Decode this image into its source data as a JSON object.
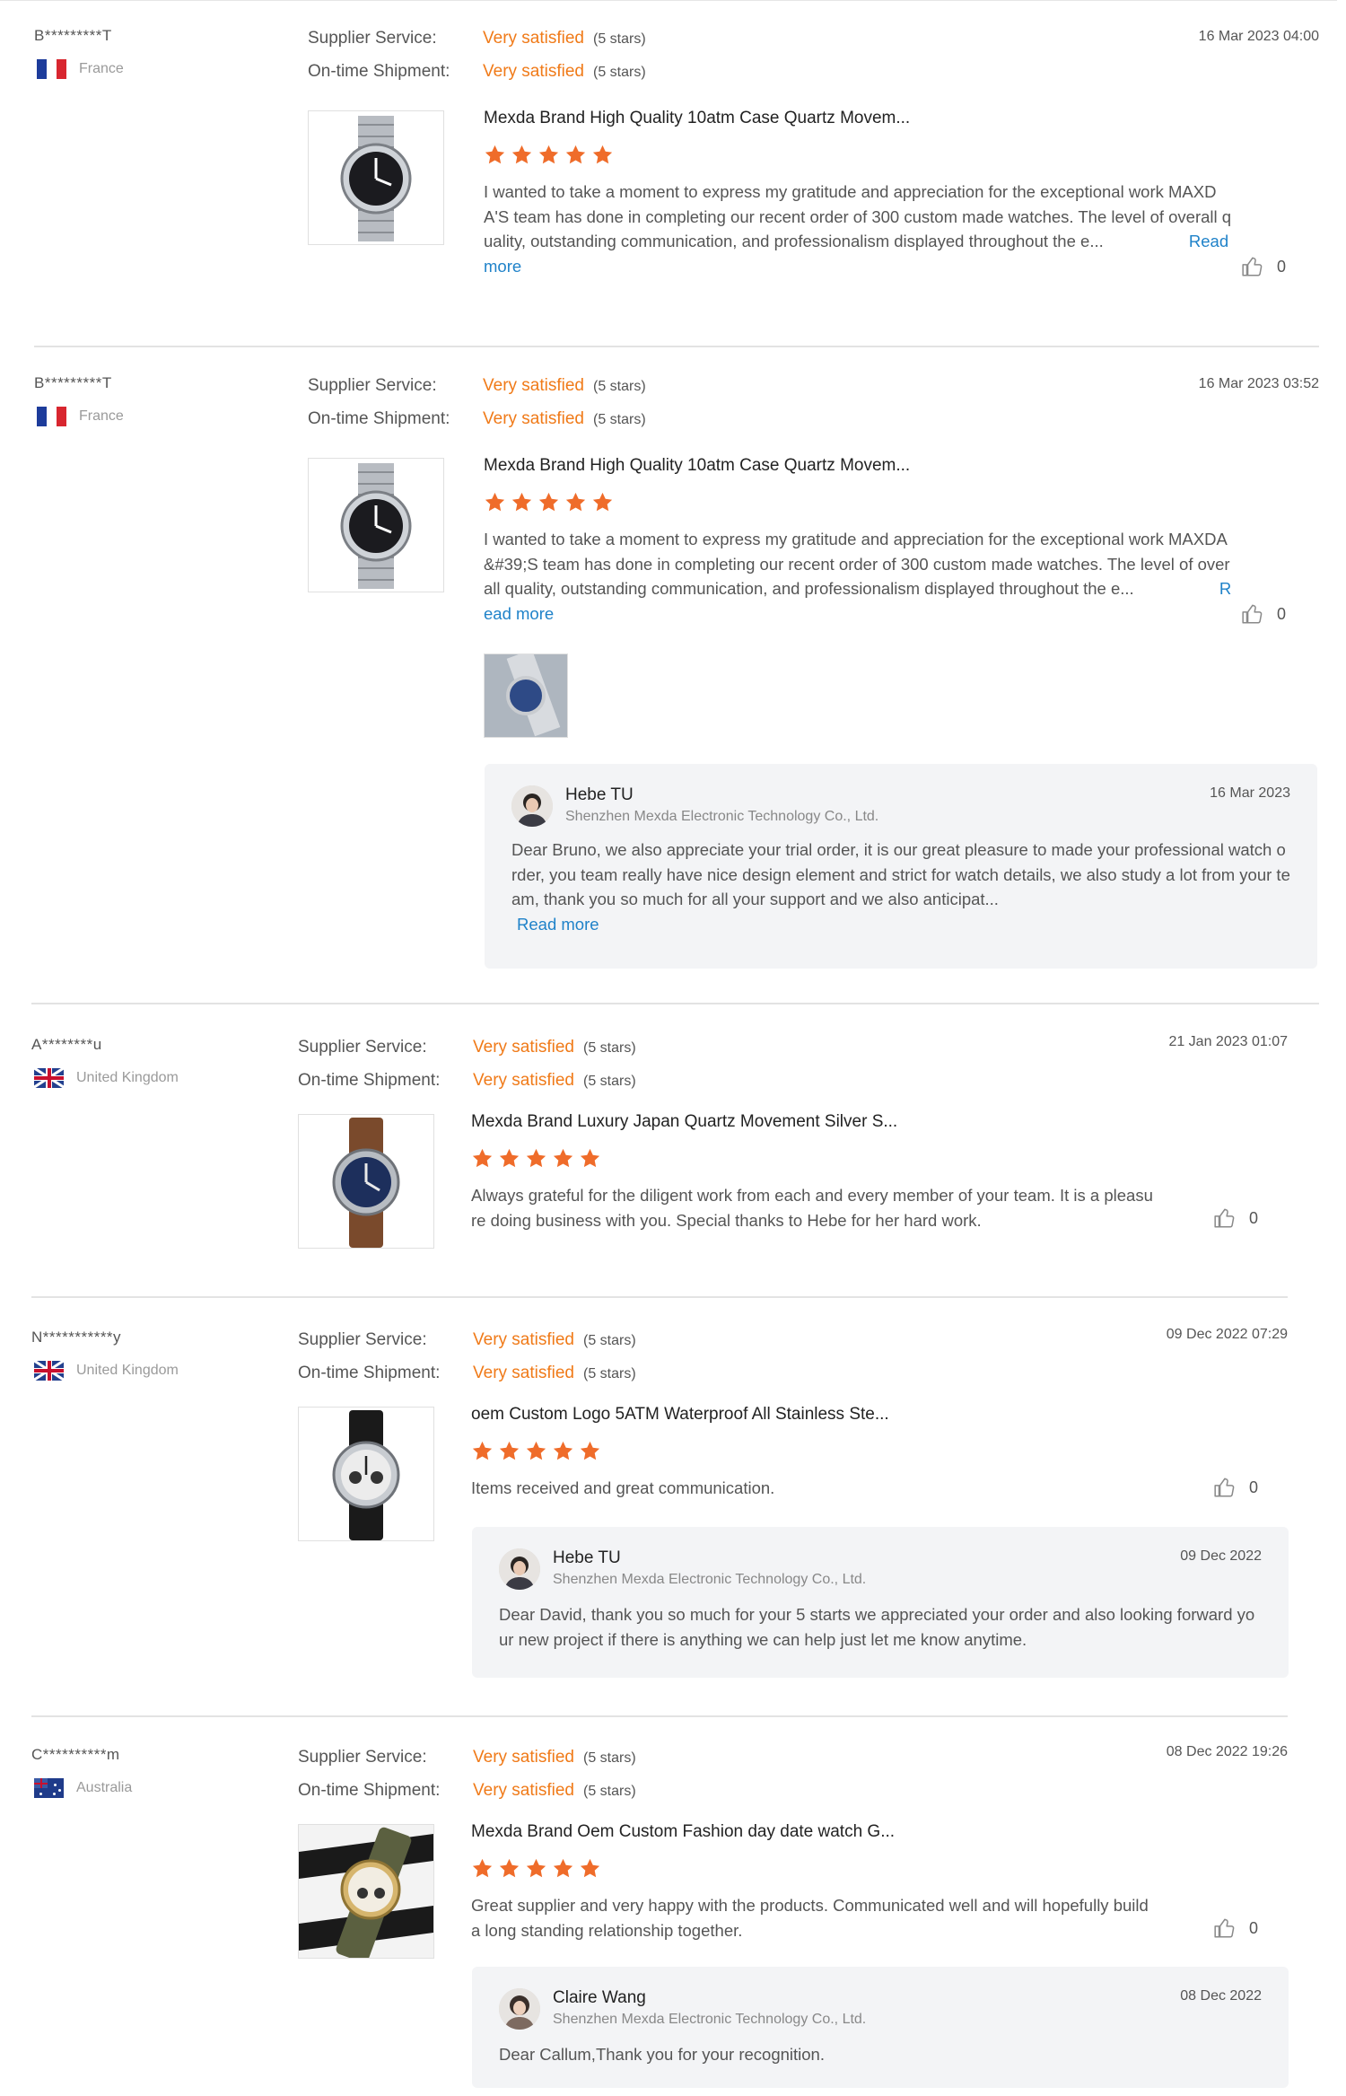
{
  "labels": {
    "supplier_service": "Supplier Service:",
    "ontime_shipment": "On-time Shipment:",
    "read_more": "Read more",
    "stars_icon": "star-icon",
    "like_icon": "thumbs-up-icon"
  },
  "colors": {
    "accent": "#f07a18",
    "link": "#1f82c9",
    "star": "#ef6c2a"
  },
  "reviews": [
    {
      "buyer": "B*********T",
      "country": "France",
      "flag": "france-flag",
      "supplier_service": {
        "value": "Very satisfied",
        "stars": "(5 stars)"
      },
      "ontime_shipment": {
        "value": "Very satisfied",
        "stars": "(5 stars)"
      },
      "date": "16 Mar 2023 04:00",
      "product_title": "Mexda Brand High Quality 10atm Case Quartz Movem...",
      "rating": 5,
      "text": "I wanted to take a moment to express my gratitude and appreciation for the exceptional work MAXDA'S team has done in completing our recent order of 300 custom made watches. The level of overall quality, outstanding communication, and professionalism displayed throughout the e...",
      "likes": "0"
    },
    {
      "buyer": "B*********T",
      "country": "France",
      "flag": "france-flag",
      "supplier_service": {
        "value": "Very satisfied",
        "stars": "(5 stars)"
      },
      "ontime_shipment": {
        "value": "Very satisfied",
        "stars": "(5 stars)"
      },
      "date": "16 Mar 2023 03:52",
      "product_title": "Mexda Brand High Quality 10atm Case Quartz Movem...",
      "rating": 5,
      "text": "I wanted to take a moment to express my gratitude and appreciation for the exceptional work MAXDA&#39;S team has done in completing our recent order of 300 custom made watches. The level of overall quality, outstanding communication, and professionalism displayed throughout the e...",
      "likes": "0",
      "reply": {
        "name": "Hebe TU",
        "company": "Shenzhen Mexda Electronic Technology Co., Ltd.",
        "date": "16 Mar 2023",
        "text": "Dear Bruno, we also appreciate your trial order, it is our great pleasure to made your professional watch order, you team really have nice design element and strict for watch details, we also study a lot from your team, thank you so much for all your support and we also anticipat..."
      }
    },
    {
      "buyer": "A********u",
      "country": "United Kingdom",
      "flag": "uk-flag",
      "supplier_service": {
        "value": "Very satisfied",
        "stars": "(5 stars)"
      },
      "ontime_shipment": {
        "value": "Very satisfied",
        "stars": "(5 stars)"
      },
      "date": "21 Jan 2023 01:07",
      "product_title": "Mexda Brand Luxury Japan Quartz Movement Silver S...",
      "rating": 5,
      "text": "Always grateful for the diligent work from each and every member of your team. It is a pleasure doing business with you. Special thanks to Hebe for her hard work.",
      "likes": "0"
    },
    {
      "buyer": "N***********y",
      "country": "United Kingdom",
      "flag": "uk-flag",
      "supplier_service": {
        "value": "Very satisfied",
        "stars": "(5 stars)"
      },
      "ontime_shipment": {
        "value": "Very satisfied",
        "stars": "(5 stars)"
      },
      "date": "09 Dec 2022 07:29",
      "product_title": "oem Custom Logo 5ATM Waterproof All Stainless Ste...",
      "rating": 5,
      "text": "Items received and great communication.",
      "likes": "0",
      "reply": {
        "name": "Hebe TU",
        "company": "Shenzhen Mexda Electronic Technology Co., Ltd.",
        "date": "09 Dec 2022",
        "text": "Dear David, thank you so much for your 5 starts we appreciated your order and also looking forward your new project if there is anything we can help just let me know anytime."
      }
    },
    {
      "buyer": "C**********m",
      "country": "Australia",
      "flag": "australia-flag",
      "supplier_service": {
        "value": "Very satisfied",
        "stars": "(5 stars)"
      },
      "ontime_shipment": {
        "value": "Very satisfied",
        "stars": "(5 stars)"
      },
      "date": "08 Dec 2022 19:26",
      "product_title": "Mexda Brand Oem Custom Fashion day date watch G...",
      "rating": 5,
      "text": "Great supplier and very happy with the products. Communicated well and will hopefully build a long standing relationship together.",
      "likes": "0",
      "reply": {
        "name": "Claire Wang",
        "company": "Shenzhen Mexda Electronic Technology Co., Ltd.",
        "date": "08 Dec 2022",
        "text": "Dear Callum,Thank you for your recognition."
      }
    }
  ]
}
